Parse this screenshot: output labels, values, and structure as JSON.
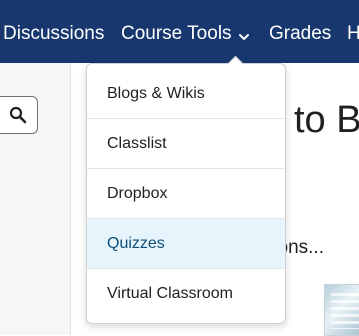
{
  "navbar": {
    "items": [
      {
        "label": "Discussions"
      },
      {
        "label": "Course Tools"
      },
      {
        "label": "Grades"
      },
      {
        "label": "H"
      }
    ]
  },
  "dropdown": {
    "items": [
      {
        "label": "Blogs & Wikis"
      },
      {
        "label": "Classlist"
      },
      {
        "label": "Dropbox"
      },
      {
        "label": "Quizzes",
        "active": true
      },
      {
        "label": "Virtual Classroom"
      }
    ]
  },
  "content": {
    "heading_fragment": "to B",
    "text_fragment": "tions..."
  },
  "colors": {
    "navbar_bg": "#17376e",
    "active_item_bg": "#e6f5fb",
    "active_item_text": "#0d4f7a"
  },
  "icons": {
    "search": "search-icon",
    "chevron": "chevron-down-icon"
  }
}
